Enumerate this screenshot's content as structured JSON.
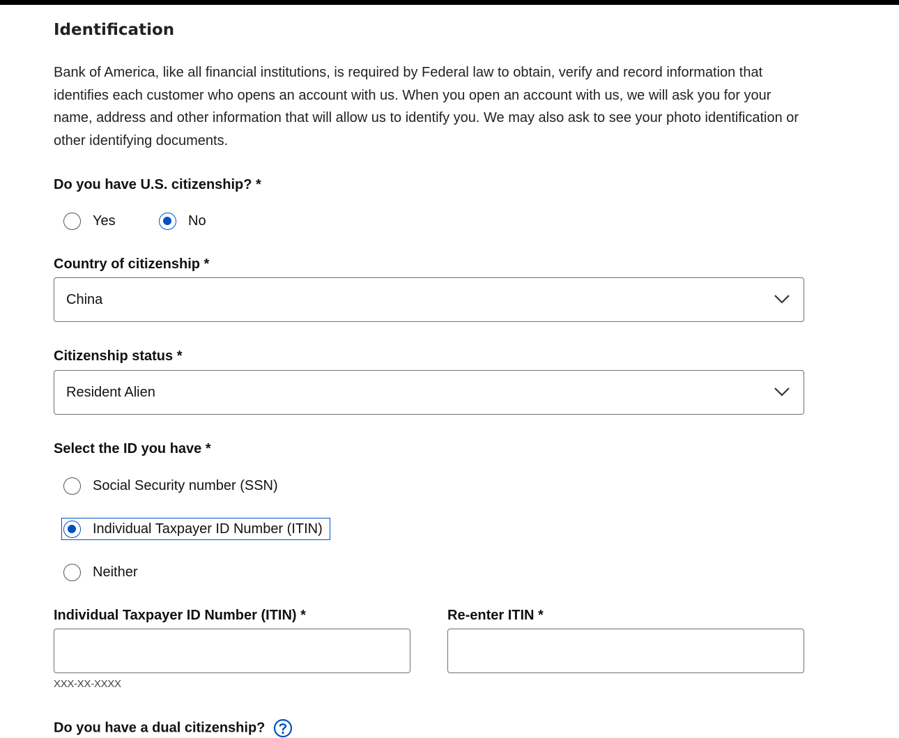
{
  "identification": {
    "title": "Identification",
    "intro": "Bank of America, like all financial institutions, is required by Federal law to obtain, verify and record information that identifies each customer who opens an account with us. When you open an account with us, we will ask you for your name, address and other information that will allow us to identify you. We may also ask to see your photo identification or other identifying documents."
  },
  "citizenship": {
    "label": "Do you have U.S. citizenship? *",
    "options": [
      {
        "label": "Yes",
        "checked": false
      },
      {
        "label": "No",
        "checked": true
      }
    ]
  },
  "country": {
    "label": "Country of citizenship *",
    "value": "China"
  },
  "status": {
    "label": "Citizenship status *",
    "value": "Resident Alien"
  },
  "id_type": {
    "label": "Select the ID you have *",
    "options": [
      {
        "label": "Social Security number (SSN)",
        "checked": false
      },
      {
        "label": "Individual Taxpayer ID Number (ITIN)",
        "checked": true
      },
      {
        "label": "Neither",
        "checked": false
      }
    ]
  },
  "itin": {
    "label": "Individual Taxpayer ID Number (ITIN)  *",
    "value": "",
    "hint": "XXX-XX-XXXX"
  },
  "itin_confirm": {
    "label": "Re-enter ITIN *",
    "value": ""
  },
  "dual_citizenship": {
    "label": "Do you have a dual citizenship?"
  },
  "colors": {
    "accent": "#0052c2",
    "border": "#707070",
    "topbar": "#000000"
  },
  "icons": {
    "select": "chevron-down-icon",
    "help": "question-circle-icon"
  }
}
